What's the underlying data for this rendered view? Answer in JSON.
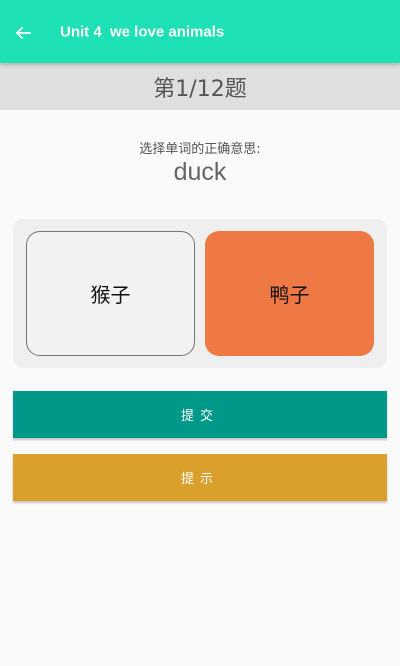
{
  "app_bar": {
    "title": "Unit 4  we love animals",
    "back_icon": "arrow-left-icon",
    "color": "#1de0b4"
  },
  "progress": {
    "label": "第1/12题",
    "current": 1,
    "total": 12
  },
  "question": {
    "prompt": "选择单词的正确意思:",
    "word": "duck"
  },
  "options": [
    {
      "label": "猴子",
      "selected": false
    },
    {
      "label": "鸭子",
      "selected": true,
      "color": "#ef7944"
    }
  ],
  "buttons": {
    "submit_label": "提交",
    "submit_color": "#009888",
    "hint_label": "提示",
    "hint_color": "#dba02c"
  }
}
